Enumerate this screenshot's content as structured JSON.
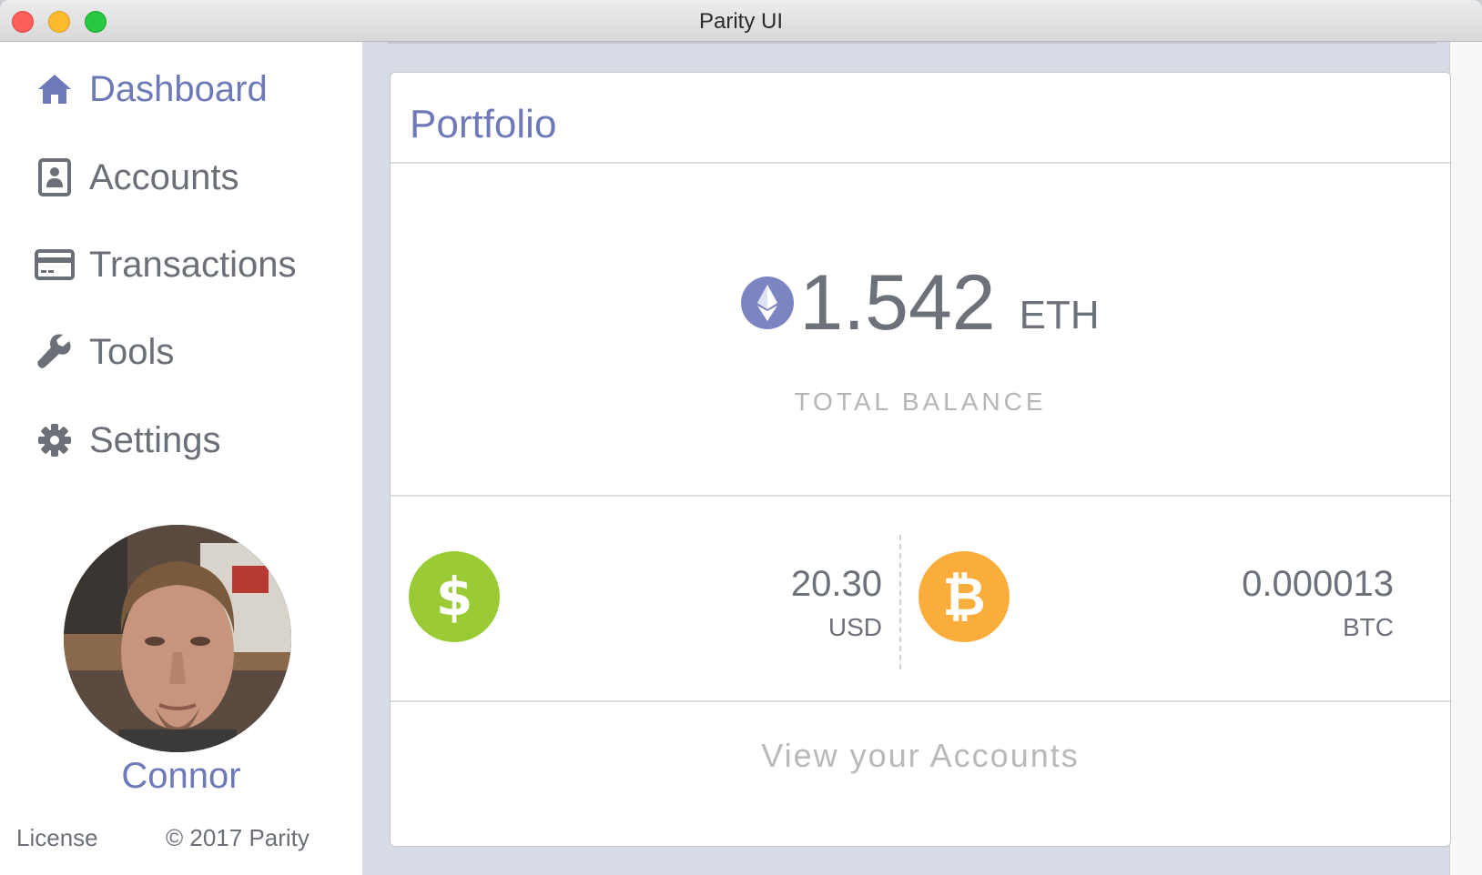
{
  "window": {
    "title": "Parity UI"
  },
  "sidebar": {
    "items": [
      {
        "label": "Dashboard",
        "icon": "home-icon",
        "active": true
      },
      {
        "label": "Accounts",
        "icon": "contact-card-icon",
        "active": false
      },
      {
        "label": "Transactions",
        "icon": "credit-card-icon",
        "active": false
      },
      {
        "label": "Tools",
        "icon": "wrench-icon",
        "active": false
      },
      {
        "label": "Settings",
        "icon": "gear-icon",
        "active": false
      }
    ],
    "user": {
      "name": "Connor"
    },
    "footer": {
      "license": "License",
      "copyright": "© 2017 Parity"
    }
  },
  "portfolio": {
    "title": "Portfolio",
    "eth_amount": "1.542",
    "eth_unit": "ETH",
    "total_label": "TOTAL BALANCE",
    "usd": {
      "amount": "20.30",
      "unit": "USD",
      "symbol": "$"
    },
    "btc": {
      "amount": "0.000013",
      "unit": "BTC",
      "symbol": "₿"
    },
    "view_accounts": "View your Accounts"
  },
  "colors": {
    "accent": "#6e79b8",
    "eth_icon": "#7b85c2",
    "usd_icon": "#9acb34",
    "btc_icon": "#faad3a",
    "main_background": "#d7dbe5"
  }
}
